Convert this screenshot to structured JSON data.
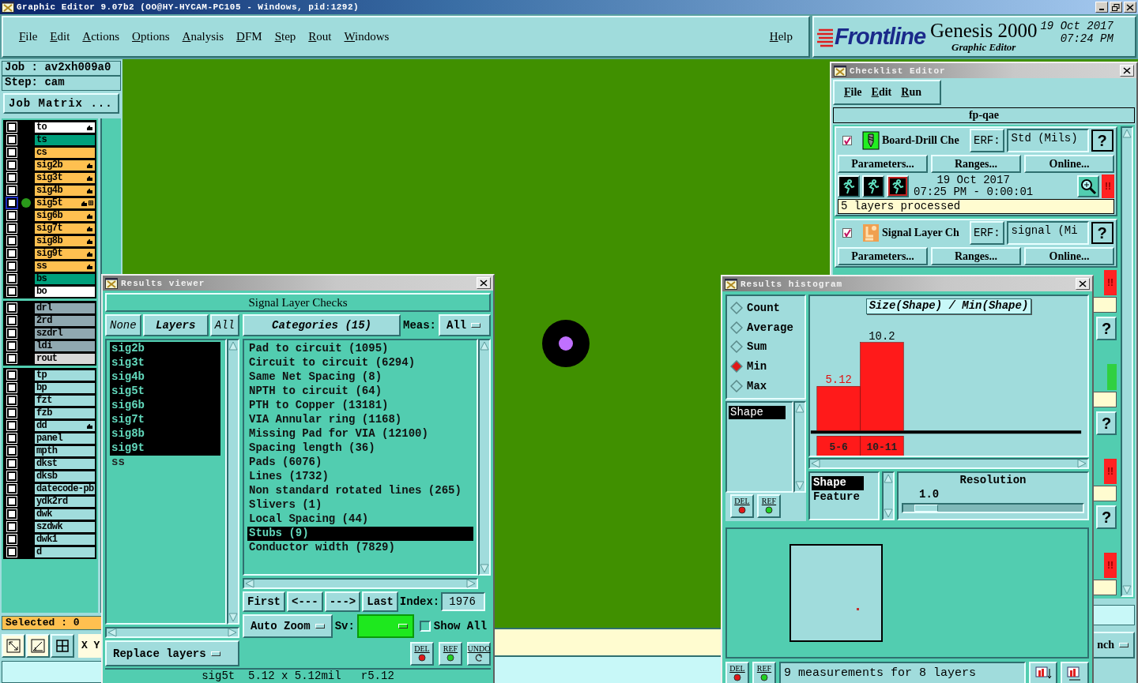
{
  "app": {
    "title": "Graphic Editor 9.07b2 (OO@HY-HYCAM-PC105 - Windows, pid:1292)"
  },
  "menu": {
    "items": [
      "File",
      "Edit",
      "Actions",
      "Options",
      "Analysis",
      "DFM",
      "Step",
      "Rout",
      "Windows"
    ],
    "help": "Help"
  },
  "brand": {
    "logo": "Frontline",
    "product": "Genesis 2000",
    "module": "Graphic Editor",
    "date": "19 Oct 2017",
    "time": "07:24 PM"
  },
  "job_panel": {
    "job": "Job : av2xh009a0",
    "step": "Step: cam",
    "matrix_button": "Job Matrix ...",
    "selected": "Selected : 0",
    "coords": "X Y"
  },
  "layer_groups": [
    [
      {
        "name": "to",
        "color": "#ffffff",
        "checked": false,
        "affected": true,
        "work": false
      },
      {
        "name": "ts",
        "color": "#00a07c",
        "checked": false,
        "affected": false,
        "work": false
      },
      {
        "name": "cs",
        "color": "#ffc050",
        "checked": false,
        "affected": false,
        "work": false
      },
      {
        "name": "sig2b",
        "color": "#ffc050",
        "checked": false,
        "affected": true,
        "work": false
      },
      {
        "name": "sig3t",
        "color": "#ffc050",
        "checked": false,
        "affected": true,
        "work": false
      },
      {
        "name": "sig4b",
        "color": "#ffc050",
        "checked": false,
        "affected": true,
        "work": false
      },
      {
        "name": "sig5t",
        "color": "#ffc050",
        "checked": false,
        "affected": true,
        "work": true
      },
      {
        "name": "sig6b",
        "color": "#ffc050",
        "checked": false,
        "affected": true,
        "work": false
      },
      {
        "name": "sig7t",
        "color": "#ffc050",
        "checked": false,
        "affected": true,
        "work": false
      },
      {
        "name": "sig8b",
        "color": "#ffc050",
        "checked": false,
        "affected": true,
        "work": false
      },
      {
        "name": "sig9t",
        "color": "#ffc050",
        "checked": false,
        "affected": true,
        "work": false
      },
      {
        "name": "ss",
        "color": "#ffc050",
        "checked": false,
        "affected": true,
        "work": false
      },
      {
        "name": "bs",
        "color": "#00a07c",
        "checked": false,
        "affected": false,
        "work": false
      },
      {
        "name": "bo",
        "color": "#ffffff",
        "checked": false,
        "affected": false,
        "work": false
      }
    ],
    [
      {
        "name": "drl",
        "color": "#90a8b0",
        "checked": false,
        "affected": false,
        "work": false
      },
      {
        "name": "2rd",
        "color": "#90a8b0",
        "checked": false,
        "affected": false,
        "work": false
      },
      {
        "name": "szdrl",
        "color": "#90a8b0",
        "checked": false,
        "affected": false,
        "work": false
      },
      {
        "name": "ldi",
        "color": "#90a8b0",
        "checked": false,
        "affected": false,
        "work": false
      },
      {
        "name": "rout",
        "color": "#d8d8d8",
        "checked": false,
        "affected": false,
        "work": false
      }
    ],
    [
      {
        "name": "tp",
        "color": "#a0dcdc",
        "checked": false,
        "affected": false,
        "work": false
      },
      {
        "name": "bp",
        "color": "#a0dcdc",
        "checked": false,
        "affected": false,
        "work": false
      },
      {
        "name": "fzt",
        "color": "#a0dcdc",
        "checked": false,
        "affected": false,
        "work": false
      },
      {
        "name": "fzb",
        "color": "#a0dcdc",
        "checked": false,
        "affected": false,
        "work": false
      },
      {
        "name": "dd",
        "color": "#a0dcdc",
        "checked": false,
        "affected": true,
        "work": false
      },
      {
        "name": "panel",
        "color": "#a0dcdc",
        "checked": false,
        "affected": false,
        "work": false
      },
      {
        "name": "mpth",
        "color": "#a0dcdc",
        "checked": false,
        "affected": false,
        "work": false
      },
      {
        "name": "dkst",
        "color": "#a0dcdc",
        "checked": false,
        "affected": false,
        "work": false
      },
      {
        "name": "dksb",
        "color": "#a0dcdc",
        "checked": false,
        "affected": false,
        "work": false
      },
      {
        "name": "datecode-pb",
        "color": "#a0dcdc",
        "checked": false,
        "affected": false,
        "work": false
      },
      {
        "name": "ydk2rd",
        "color": "#a0dcdc",
        "checked": false,
        "affected": false,
        "work": false
      },
      {
        "name": "dwk",
        "color": "#a0dcdc",
        "checked": false,
        "affected": false,
        "work": false
      },
      {
        "name": "szdwk",
        "color": "#a0dcdc",
        "checked": false,
        "affected": false,
        "work": false
      },
      {
        "name": "dwk1",
        "color": "#a0dcdc",
        "checked": false,
        "affected": false,
        "work": false
      },
      {
        "name": "d",
        "color": "#a0dcdc",
        "checked": false,
        "affected": false,
        "work": false
      }
    ]
  ],
  "results_viewer": {
    "title": "Results viewer",
    "heading": "Signal Layer Checks",
    "layer_buttons": [
      "None",
      "Layers",
      "All"
    ],
    "layers": [
      {
        "name": "sig2b",
        "selected": true
      },
      {
        "name": "sig3t",
        "selected": true
      },
      {
        "name": "sig4b",
        "selected": true
      },
      {
        "name": "sig5t",
        "selected": true
      },
      {
        "name": "sig6b",
        "selected": true
      },
      {
        "name": "sig7t",
        "selected": true
      },
      {
        "name": "sig8b",
        "selected": true
      },
      {
        "name": "sig9t",
        "selected": true
      },
      {
        "name": "ss",
        "selected": false
      }
    ],
    "categories_button": "Categories (15)",
    "meas_label": "Meas:",
    "meas_value": "All",
    "categories": [
      {
        "label": "Pad to circuit (1095)",
        "selected": false
      },
      {
        "label": "Circuit to circuit (6294)",
        "selected": false
      },
      {
        "label": "Same Net Spacing (8)",
        "selected": false
      },
      {
        "label": "NPTH to circuit (64)",
        "selected": false
      },
      {
        "label": "PTH to Copper (13181)",
        "selected": false
      },
      {
        "label": "VIA Annular ring (1168)",
        "selected": false
      },
      {
        "label": "Missing Pad for VIA (12100)",
        "selected": false
      },
      {
        "label": "Spacing length (36)",
        "selected": false
      },
      {
        "label": "Pads (6076)",
        "selected": false
      },
      {
        "label": "Lines (1732)",
        "selected": false
      },
      {
        "label": "Non standard rotated lines (265)",
        "selected": false
      },
      {
        "label": "Slivers (1)",
        "selected": false
      },
      {
        "label": "Local Spacing (44)",
        "selected": false
      },
      {
        "label": "Stubs (9)",
        "selected": true
      },
      {
        "label": "Conductor width (7829)",
        "selected": false
      }
    ],
    "nav": [
      "First",
      "<---",
      "--->",
      "Last"
    ],
    "index_label": "Index:",
    "index_value": "1976",
    "zoom": "Auto Zoom",
    "sv_label": "Sv:",
    "show_all": {
      "label": "Show All",
      "checked": false
    },
    "replace": "Replace layers",
    "tools": [
      "DEL",
      "REF",
      "UNDO"
    ],
    "status": "sig5t  5.12 x 5.12mil   r5.12"
  },
  "histogram": {
    "title": "Results histogram",
    "modes": [
      {
        "label": "Count",
        "selected": false
      },
      {
        "label": "Average",
        "selected": false
      },
      {
        "label": "Sum",
        "selected": false
      },
      {
        "label": "Min",
        "selected": true
      },
      {
        "label": "Max",
        "selected": false
      }
    ],
    "attributes": [
      {
        "label": "Shape",
        "selected": true
      }
    ],
    "tools": [
      "DEL",
      "REF"
    ],
    "chart_data": {
      "type": "bar",
      "title": "Size(Shape) / Min(Shape)",
      "categories": [
        "5-6",
        "10-11"
      ],
      "series": [
        {
          "color": "#ff1a1a",
          "values": [
            5.12,
            10.2
          ]
        }
      ],
      "data_labels": true
    },
    "fields": [
      {
        "label": "Shape",
        "selected": true
      },
      {
        "label": "Feature",
        "selected": false
      }
    ],
    "resolution": {
      "label": "Resolution",
      "value": "1.0",
      "level": 0.06
    },
    "footer_tools": [
      "DEL",
      "REF"
    ],
    "message": "9 measurements for 8 layers"
  },
  "checklist": {
    "title": "Checklist Editor",
    "menu": [
      "File",
      "Edit",
      "Run"
    ],
    "name": "fp-qae",
    "checks": [
      {
        "checked": true,
        "kind": "drill",
        "name": "Board-Drill Che",
        "erf_label": "ERF:",
        "erf": "Std (Mils)",
        "help": "?",
        "buttons": [
          "Parameters...",
          "Ranges...",
          "Online..."
        ],
        "date": "19 Oct 2017",
        "time": "07:25 PM - 0:00:01",
        "alert": "!!",
        "status": "5 layers processed"
      },
      {
        "checked": true,
        "kind": "signal",
        "name": "Signal Layer Ch",
        "erf_label": "ERF:",
        "erf": "signal (Mi",
        "help": "?",
        "buttons": [
          "Parameters...",
          "Ranges...",
          "Online..."
        ]
      }
    ],
    "edge": [
      {
        "kind": "alert",
        "text": "!!"
      },
      {
        "kind": "note"
      },
      {
        "kind": "help",
        "text": "?"
      },
      {
        "kind": "ok"
      },
      {
        "kind": "note"
      },
      {
        "kind": "help",
        "text": "?"
      },
      {
        "kind": "alert",
        "text": "!!"
      },
      {
        "kind": "note"
      },
      {
        "kind": "help",
        "text": "?"
      },
      {
        "kind": "alert",
        "text": "!!"
      },
      {
        "kind": "note"
      }
    ],
    "edge_button": "nch"
  }
}
